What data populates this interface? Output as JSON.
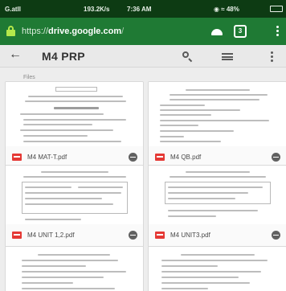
{
  "status_bar": {
    "signal": "G.atll",
    "speed": "193.2K/s",
    "time": "7:36 AM",
    "right_icons": "◉ ≈ 48%"
  },
  "browser": {
    "url_prefix": "https://",
    "url_domain": "drive.google.com",
    "url_tail": "/",
    "tab_count": "3",
    "lock_icon": "lock-icon",
    "home_icon": "home-icon",
    "tabs_icon": "tabs-icon",
    "menu_icon": "more-vert-icon",
    "lock_color": "#b4e84b"
  },
  "app_bar": {
    "back_glyph": "←",
    "title": "M4 PRP",
    "search_icon": "search-icon",
    "view_icon": "list-view-icon",
    "menu_icon": "more-vert-icon"
  },
  "section_label": "Files",
  "files": [
    {
      "name": "M4 MAT-T.pdf"
    },
    {
      "name": "M4 QB.pdf"
    },
    {
      "name": "M4 UNIT 1,2.pdf"
    },
    {
      "name": "M4 UNIT3.pdf"
    },
    {
      "name": ""
    },
    {
      "name": ""
    }
  ],
  "colors": {
    "status_bar": "#0d3b13",
    "browser_bar": "#1f7a34",
    "app_bar": "#e9e9e9",
    "background": "#ededed",
    "pdf_red": "#e53935"
  }
}
